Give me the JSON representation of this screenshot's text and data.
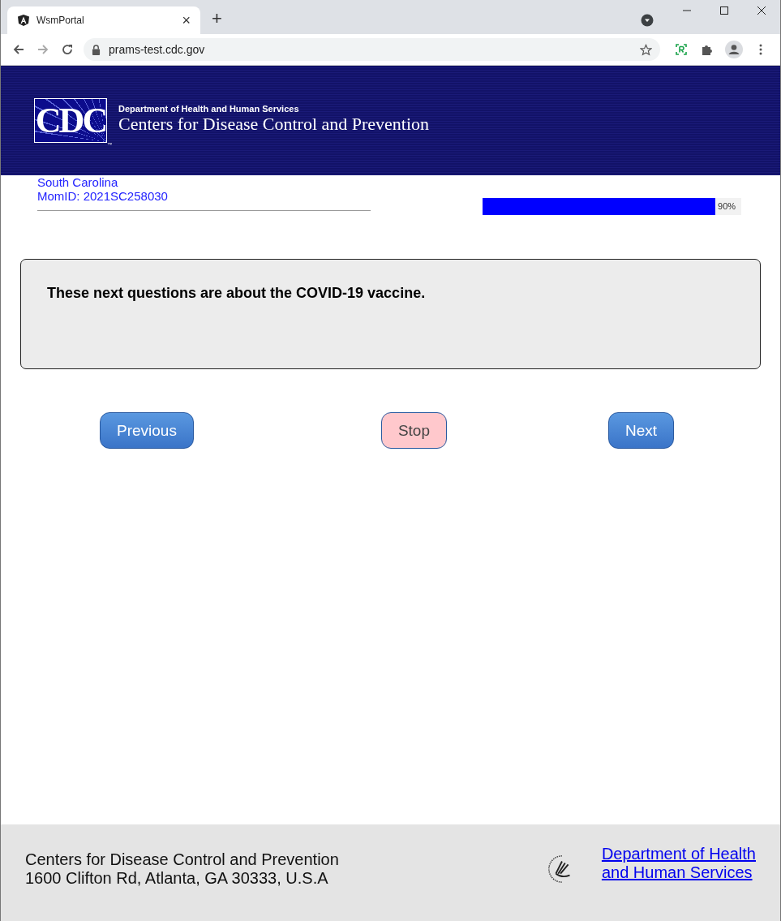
{
  "browser": {
    "tab": {
      "title": "WsmPortal",
      "close": "×"
    },
    "new_tab": "+",
    "url": "prams-test.cdc.gov"
  },
  "header": {
    "logo": "CDC",
    "trademark": "™",
    "department": "Department of Health and Human Services",
    "agency": "Centers for Disease Control and Prevention"
  },
  "respondent": {
    "state": "South Carolina",
    "mom_id": "MomID: 2021SC258030"
  },
  "progress": {
    "level": 0.9,
    "reading": "90%"
  },
  "question": "These next questions are about the COVID-19 vaccine.",
  "buttons": [
    {
      "label": "Previous",
      "kind": "nav"
    },
    {
      "label": "Stop",
      "kind": "stop"
    },
    {
      "label": "Next",
      "kind": "nav"
    }
  ],
  "footer": {
    "lines": [
      "Centers for Disease Control and Prevention",
      "1600 Clifton Rd, Atlanta, GA 30333, U.S.A"
    ],
    "link": [
      "Department of Health",
      "and Human Services"
    ]
  }
}
